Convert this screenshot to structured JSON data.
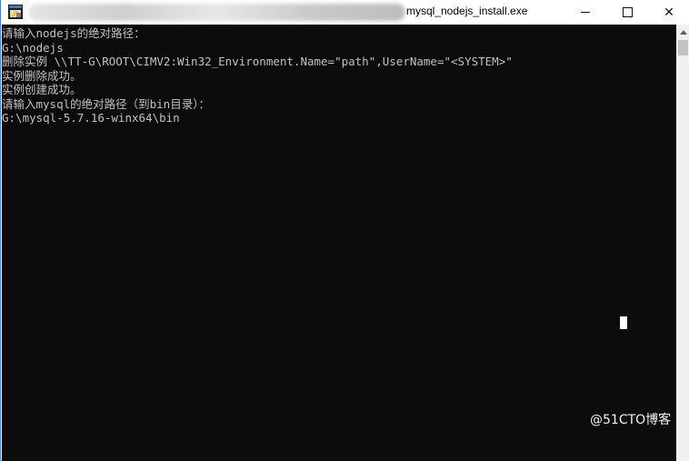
{
  "window": {
    "title": "mysql_nodejs_install.exe",
    "controls": {
      "minimize": "minimize",
      "maximize": "maximize",
      "close": "✕"
    }
  },
  "console": {
    "lines": [
      "请输入nodejs的绝对路径：",
      "G:\\nodejs",
      "删除实例 \\\\TT-G\\ROOT\\CIMV2:Win32_Environment.Name=\"path\",UserName=\"<SYSTEM>\"",
      "实例删除成功。",
      "实例创建成功。",
      "请输入mysql的绝对路径（到bin目录）：",
      "G:\\mysql-5.7.16-winx64\\bin"
    ]
  },
  "watermark": "@51CTO博客",
  "icons": {
    "app": "console-app-icon",
    "scroll_up": "chevron-up-icon"
  },
  "colors": {
    "console_bg": "#0c0c0c",
    "console_text": "#c0c0c0",
    "window_border": "#3c7ee8"
  }
}
